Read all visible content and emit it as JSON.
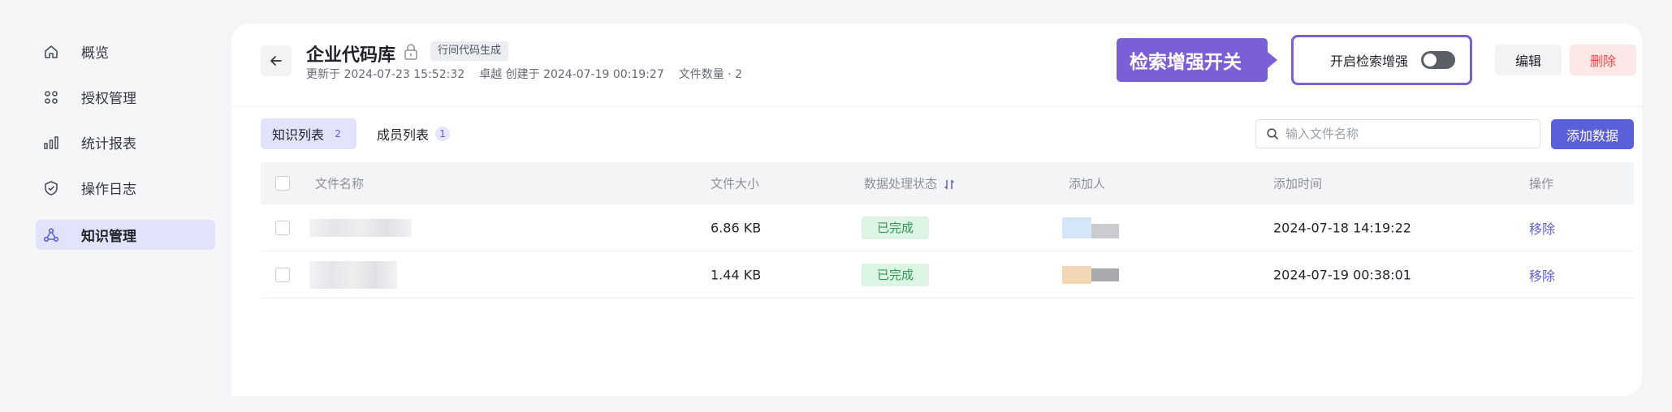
{
  "sidebar": {
    "items": [
      {
        "label": "概览",
        "icon": "home-icon",
        "active": false
      },
      {
        "label": "授权管理",
        "icon": "apps-icon",
        "active": false
      },
      {
        "label": "统计报表",
        "icon": "bar-chart-icon",
        "active": false
      },
      {
        "label": "操作日志",
        "icon": "shield-check-icon",
        "active": false
      },
      {
        "label": "知识管理",
        "icon": "knowledge-graph-icon",
        "active": true
      }
    ]
  },
  "header": {
    "title": "企业代码库",
    "tag": "行间代码生成",
    "updated": "更新于 2024-07-23 15:52:32",
    "creator": "卓越 创建于 2024-07-19 00:19:27",
    "file_count": "文件数量 · 2",
    "callout": "检索增强开关",
    "switch_label": "开启检索增强",
    "switch_on": false,
    "edit_label": "编辑",
    "delete_label": "删除"
  },
  "tabs": [
    {
      "label": "知识列表",
      "count": "2",
      "active": true
    },
    {
      "label": "成员列表",
      "count": "1",
      "active": false
    }
  ],
  "search": {
    "placeholder": "输入文件名称"
  },
  "add_button": "添加数据",
  "table": {
    "columns": [
      "文件名称",
      "文件大小",
      "数据处理状态",
      "添加人",
      "添加时间",
      "操作"
    ],
    "rows": [
      {
        "size": "6.86 KB",
        "status": "已完成",
        "time": "2024-07-18 14:19:22",
        "action": "移除"
      },
      {
        "size": "1.44 KB",
        "status": "已完成",
        "time": "2024-07-19 00:38:01",
        "action": "移除"
      }
    ]
  },
  "colors": {
    "accent": "#5b5fd8",
    "callout": "#7c5fd6",
    "danger": "#f54a45",
    "success": "#2b9b56"
  }
}
